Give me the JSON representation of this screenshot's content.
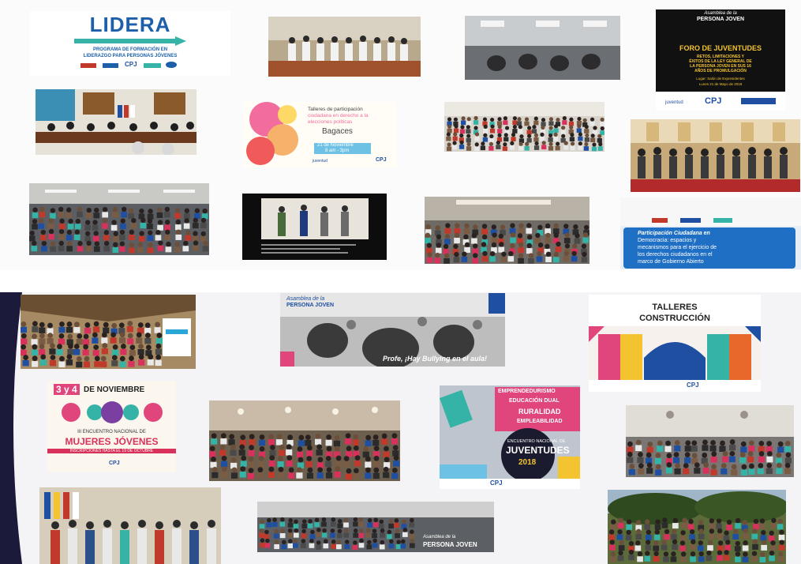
{
  "lidera": {
    "title": "LIDERA",
    "subtitle_1": "PROGRAMA DE FORMACIÓN EN",
    "subtitle_2": "LIDERAZGO PARA PERSONAS JÓVENES",
    "logo_1": "CPJ"
  },
  "foro": {
    "header_1": "Asamblea de la",
    "header_2": "PERSONA JOVEN",
    "title": "FORO DE JUVENTUDES",
    "line_1": "RETOS, LIMITACIONES Y",
    "line_2": "ÉXITOS DE LA LEY GENERAL DE",
    "line_3": "LA PERSONA JOVEN EN SUS 16",
    "line_4": "AÑOS DE PROMULGACIÓN",
    "place": "Lugar: Salón de Expresidentes",
    "date": "Lunes 21 de Mayo de 2018",
    "logo_1": "juventud",
    "logo_2": "CPJ"
  },
  "talleres": {
    "title_1": "Talleres de participación",
    "title_2": "ciudadana en derecho a la",
    "title_3": "elecciones políticas",
    "place": "Bagaces",
    "date": "21 de Noviembre",
    "time": "8 am - 3pm",
    "logo_1": "juventud",
    "logo_2": "CPJ"
  },
  "participacion": {
    "title_1": "Participación Ciudadana en",
    "title_2": "Democracia: espacios y",
    "title_3": "mecanismos para el ejercicio de",
    "title_4": "los derechos ciudadanos en el",
    "title_5": "marco de Gobierno Abierto"
  },
  "bullying": {
    "header_1": "Asamblea de la",
    "header_2": "PERSONA JOVEN",
    "caption": "Profe, ¡Hay Bullying en el aula!"
  },
  "construccion": {
    "title_1": "TALLERES",
    "title_2": "CONSTRUCCIÓN",
    "logo_1": "CPJ"
  },
  "mujeres": {
    "days": "3 y 4",
    "month": "DE NOVIEMBRE",
    "line_1": "III ENCUENTRO NACIONAL DE",
    "line_2": "MUJERES JÓVENES",
    "line_3": "INSCRIPCIONES HASTA EL 19 DE OCTUBRE",
    "logo_1": "CPJ"
  },
  "encuentro": {
    "tag_1": "EMPRENDEDURISMO",
    "tag_2": "EDUCACIÓN DUAL",
    "tag_3": "RURALIDAD",
    "tag_4": "EMPLEABILIDAD",
    "title_1": "ENCUENTRO NACIONAL DE",
    "title_2": "JUVENTUDES",
    "year": "2018",
    "logo_1": "CPJ"
  },
  "asamblea": {
    "header_1": "Asamblea de la",
    "header_2": "PERSONA JOVEN"
  },
  "colors": {
    "lidera_blue": "#1d5fa8",
    "lidera_teal": "#35b3a6",
    "foro_yellow": "#f4c430",
    "cpj_blue": "#1e4fa0",
    "mujeres_pink": "#d8315b",
    "encuentro_pink": "#e0457b"
  }
}
